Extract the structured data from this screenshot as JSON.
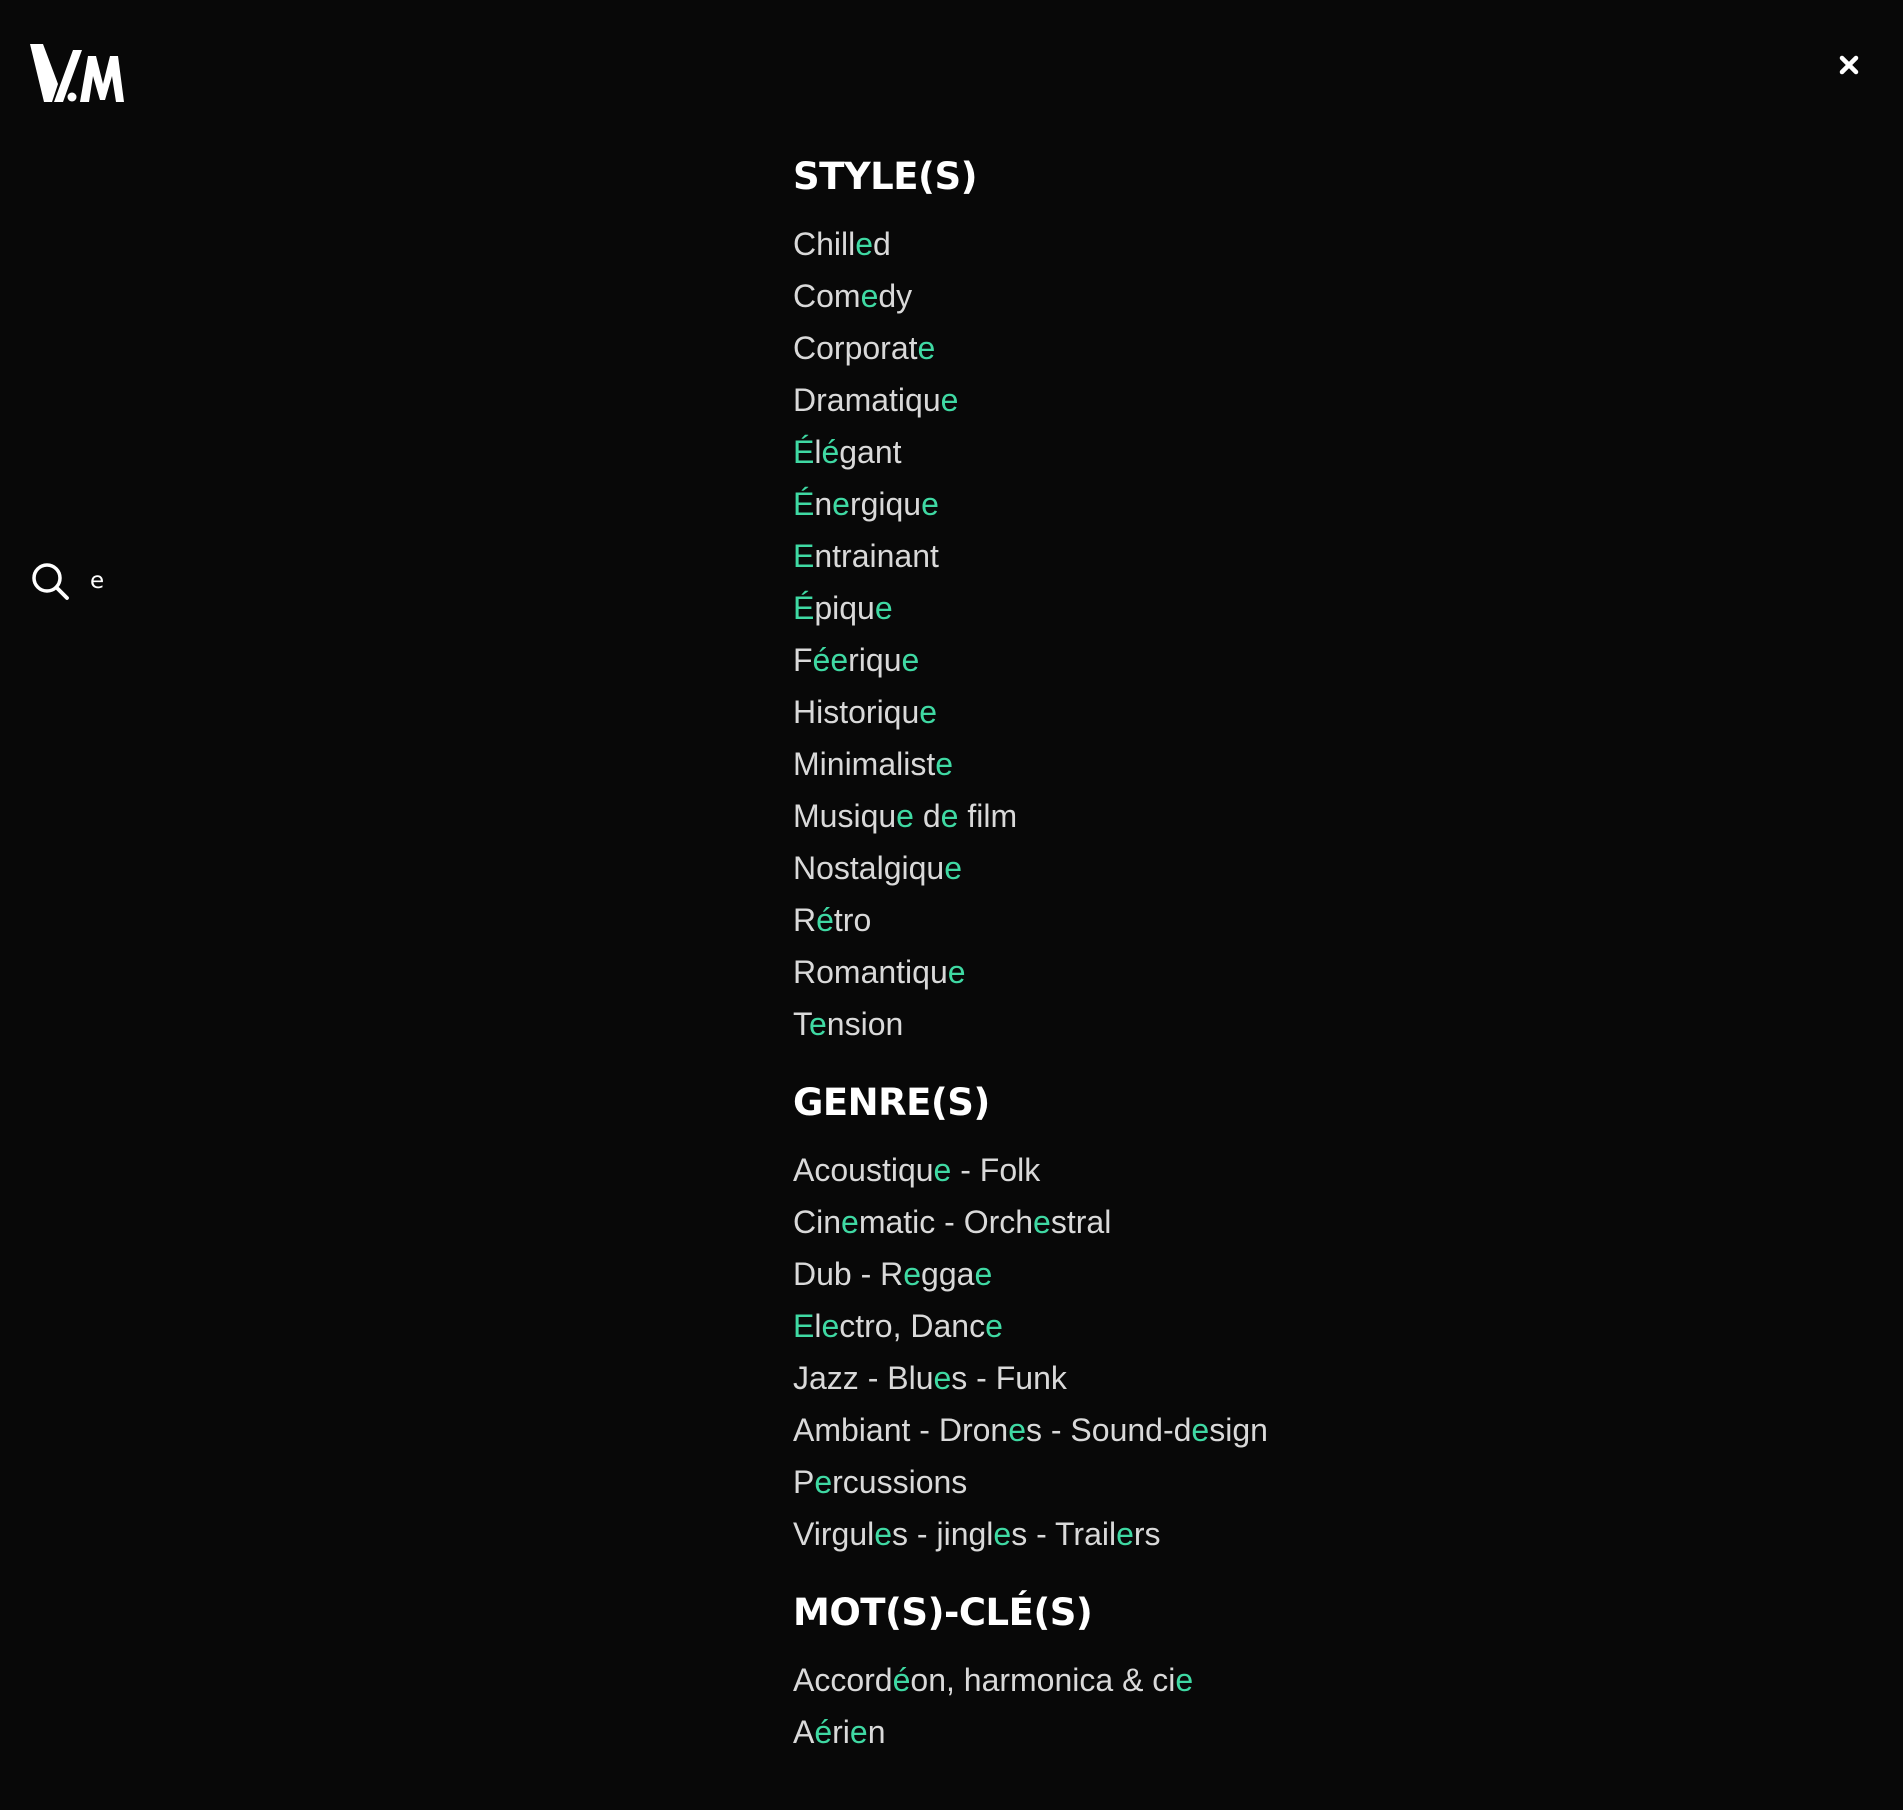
{
  "header": {
    "logo_text": "VAM",
    "close_icon": "close-icon"
  },
  "search": {
    "icon": "search-icon",
    "query": "e"
  },
  "sections": [
    {
      "title": "STYLE(S)",
      "items": [
        "Chilled",
        "Comedy",
        "Corporate",
        "Dramatique",
        "Élégant",
        "Énergique",
        "Entrainant",
        "Épique",
        "Féerique",
        "Historique",
        "Minimaliste",
        "Musique de film",
        "Nostalgique",
        "Rétro",
        "Romantique",
        "Tension"
      ]
    },
    {
      "title": "GENRE(S)",
      "items": [
        "Acoustique - Folk",
        "Cinematic - Orchestral",
        "Dub - Reggae",
        "Electro, Dance",
        "Jazz - Blues - Funk",
        "Ambiant - Drones - Sound-design",
        "Percussions",
        "Virgules - jingles - Trailers"
      ]
    },
    {
      "title": "MOT(S)-CLÉ(S)",
      "items": [
        "Accordéon, harmonica & cie",
        "Aérien"
      ]
    }
  ],
  "colors": {
    "background": "#080808",
    "text": "#d9d9d9",
    "highlight": "#3fd9a3",
    "heading": "#ffffff"
  }
}
